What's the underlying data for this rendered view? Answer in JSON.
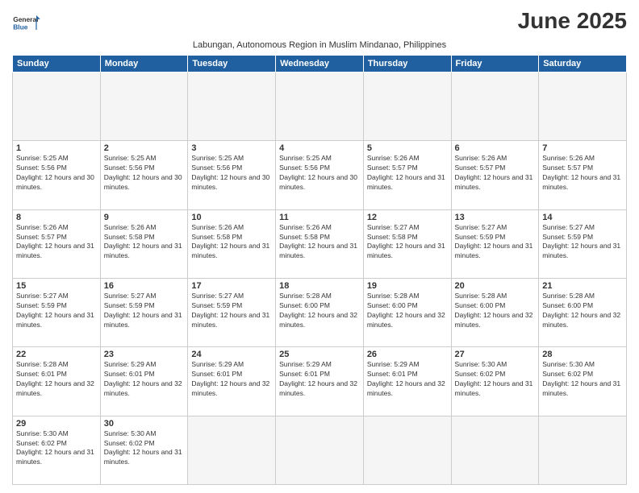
{
  "header": {
    "logo": {
      "general": "General",
      "blue": "Blue"
    },
    "title": "June 2025",
    "subtitle": "Labungan, Autonomous Region in Muslim Mindanao, Philippines"
  },
  "calendar": {
    "days_of_week": [
      "Sunday",
      "Monday",
      "Tuesday",
      "Wednesday",
      "Thursday",
      "Friday",
      "Saturday"
    ],
    "weeks": [
      [
        {
          "day": "",
          "empty": true
        },
        {
          "day": "",
          "empty": true
        },
        {
          "day": "",
          "empty": true
        },
        {
          "day": "",
          "empty": true
        },
        {
          "day": "",
          "empty": true
        },
        {
          "day": "",
          "empty": true
        },
        {
          "day": "",
          "empty": true
        }
      ],
      [
        {
          "day": "1",
          "sunrise": "5:25 AM",
          "sunset": "5:56 PM",
          "daylight": "12 hours and 30 minutes."
        },
        {
          "day": "2",
          "sunrise": "5:25 AM",
          "sunset": "5:56 PM",
          "daylight": "12 hours and 30 minutes."
        },
        {
          "day": "3",
          "sunrise": "5:25 AM",
          "sunset": "5:56 PM",
          "daylight": "12 hours and 30 minutes."
        },
        {
          "day": "4",
          "sunrise": "5:25 AM",
          "sunset": "5:56 PM",
          "daylight": "12 hours and 30 minutes."
        },
        {
          "day": "5",
          "sunrise": "5:26 AM",
          "sunset": "5:57 PM",
          "daylight": "12 hours and 31 minutes."
        },
        {
          "day": "6",
          "sunrise": "5:26 AM",
          "sunset": "5:57 PM",
          "daylight": "12 hours and 31 minutes."
        },
        {
          "day": "7",
          "sunrise": "5:26 AM",
          "sunset": "5:57 PM",
          "daylight": "12 hours and 31 minutes."
        }
      ],
      [
        {
          "day": "8",
          "sunrise": "5:26 AM",
          "sunset": "5:57 PM",
          "daylight": "12 hours and 31 minutes."
        },
        {
          "day": "9",
          "sunrise": "5:26 AM",
          "sunset": "5:58 PM",
          "daylight": "12 hours and 31 minutes."
        },
        {
          "day": "10",
          "sunrise": "5:26 AM",
          "sunset": "5:58 PM",
          "daylight": "12 hours and 31 minutes."
        },
        {
          "day": "11",
          "sunrise": "5:26 AM",
          "sunset": "5:58 PM",
          "daylight": "12 hours and 31 minutes."
        },
        {
          "day": "12",
          "sunrise": "5:27 AM",
          "sunset": "5:58 PM",
          "daylight": "12 hours and 31 minutes."
        },
        {
          "day": "13",
          "sunrise": "5:27 AM",
          "sunset": "5:59 PM",
          "daylight": "12 hours and 31 minutes."
        },
        {
          "day": "14",
          "sunrise": "5:27 AM",
          "sunset": "5:59 PM",
          "daylight": "12 hours and 31 minutes."
        }
      ],
      [
        {
          "day": "15",
          "sunrise": "5:27 AM",
          "sunset": "5:59 PM",
          "daylight": "12 hours and 31 minutes."
        },
        {
          "day": "16",
          "sunrise": "5:27 AM",
          "sunset": "5:59 PM",
          "daylight": "12 hours and 31 minutes."
        },
        {
          "day": "17",
          "sunrise": "5:27 AM",
          "sunset": "5:59 PM",
          "daylight": "12 hours and 31 minutes."
        },
        {
          "day": "18",
          "sunrise": "5:28 AM",
          "sunset": "6:00 PM",
          "daylight": "12 hours and 32 minutes."
        },
        {
          "day": "19",
          "sunrise": "5:28 AM",
          "sunset": "6:00 PM",
          "daylight": "12 hours and 32 minutes."
        },
        {
          "day": "20",
          "sunrise": "5:28 AM",
          "sunset": "6:00 PM",
          "daylight": "12 hours and 32 minutes."
        },
        {
          "day": "21",
          "sunrise": "5:28 AM",
          "sunset": "6:00 PM",
          "daylight": "12 hours and 32 minutes."
        }
      ],
      [
        {
          "day": "22",
          "sunrise": "5:28 AM",
          "sunset": "6:01 PM",
          "daylight": "12 hours and 32 minutes."
        },
        {
          "day": "23",
          "sunrise": "5:29 AM",
          "sunset": "6:01 PM",
          "daylight": "12 hours and 32 minutes."
        },
        {
          "day": "24",
          "sunrise": "5:29 AM",
          "sunset": "6:01 PM",
          "daylight": "12 hours and 32 minutes."
        },
        {
          "day": "25",
          "sunrise": "5:29 AM",
          "sunset": "6:01 PM",
          "daylight": "12 hours and 32 minutes."
        },
        {
          "day": "26",
          "sunrise": "5:29 AM",
          "sunset": "6:01 PM",
          "daylight": "12 hours and 32 minutes."
        },
        {
          "day": "27",
          "sunrise": "5:30 AM",
          "sunset": "6:02 PM",
          "daylight": "12 hours and 31 minutes."
        },
        {
          "day": "28",
          "sunrise": "5:30 AM",
          "sunset": "6:02 PM",
          "daylight": "12 hours and 31 minutes."
        }
      ],
      [
        {
          "day": "29",
          "sunrise": "5:30 AM",
          "sunset": "6:02 PM",
          "daylight": "12 hours and 31 minutes."
        },
        {
          "day": "30",
          "sunrise": "5:30 AM",
          "sunset": "6:02 PM",
          "daylight": "12 hours and 31 minutes."
        },
        {
          "day": "",
          "empty": true
        },
        {
          "day": "",
          "empty": true
        },
        {
          "day": "",
          "empty": true
        },
        {
          "day": "",
          "empty": true
        },
        {
          "day": "",
          "empty": true
        }
      ]
    ]
  }
}
